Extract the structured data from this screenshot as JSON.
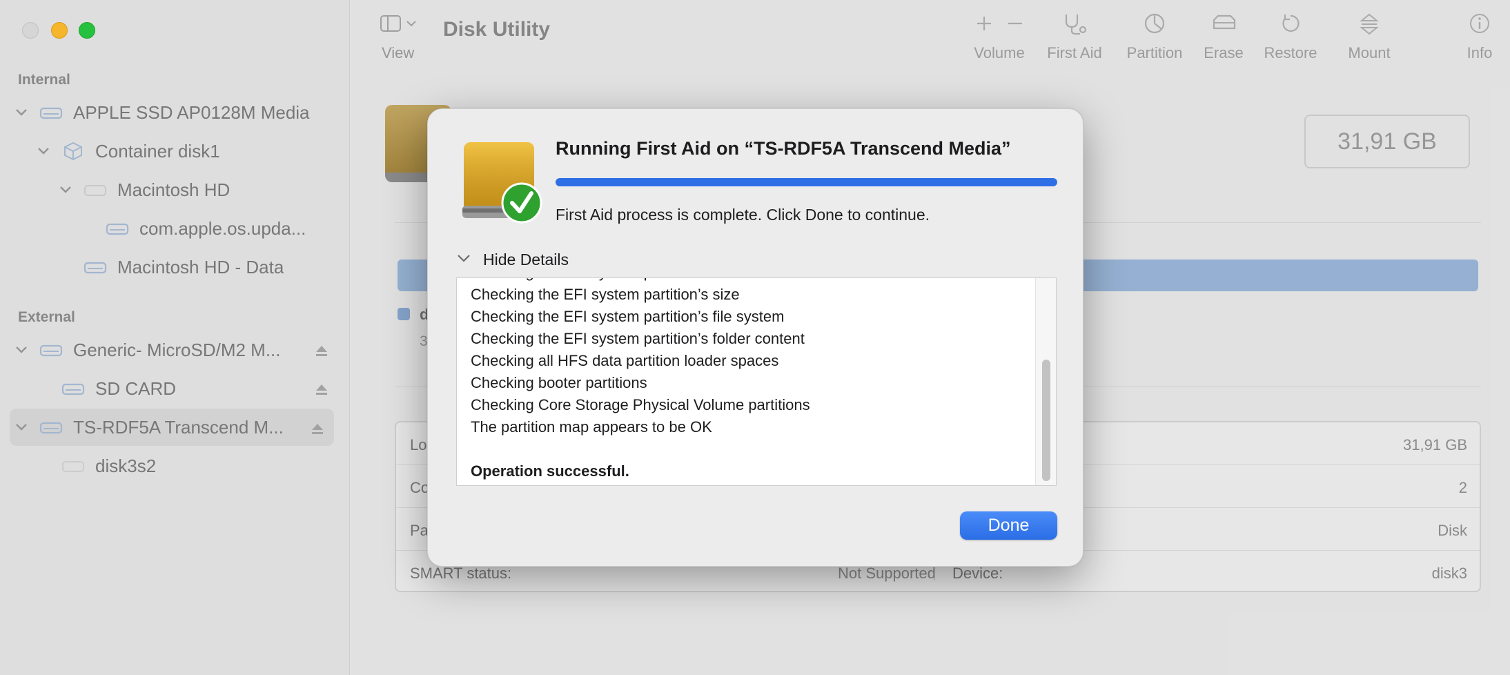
{
  "app": {
    "title": "Disk Utility"
  },
  "sidebar": {
    "internal_header": "Internal",
    "external_header": "External",
    "internal_items": [
      {
        "label": "APPLE SSD AP0128M Media",
        "icon": "drive-icon"
      },
      {
        "label": "Container disk1",
        "icon": "container-icon"
      },
      {
        "label": "Macintosh HD",
        "icon": "volume-icon"
      },
      {
        "label": "com.apple.os.upda...",
        "icon": "volume-icon"
      },
      {
        "label": "Macintosh HD - Data",
        "icon": "volume-icon"
      }
    ],
    "external_items": [
      {
        "label": "Generic- MicroSD/M2 M...",
        "icon": "drive-icon"
      },
      {
        "label": "SD CARD",
        "icon": "volume-icon"
      },
      {
        "label": "TS-RDF5A Transcend M...",
        "icon": "drive-icon"
      },
      {
        "label": "disk3s2",
        "icon": "volume-icon"
      }
    ]
  },
  "toolbar": {
    "view_label": "View",
    "volume_label": "Volume",
    "first_aid_label": "First Aid",
    "partition_label": "Partition",
    "erase_label": "Erase",
    "restore_label": "Restore",
    "mount_label": "Mount",
    "info_label": "Info"
  },
  "main": {
    "capacity": "31,91 GB",
    "legend_title": "d",
    "legend_sub": "3",
    "info_rows": [
      {
        "left_label": "Lo",
        "right_value": "31,91 GB"
      },
      {
        "left_label": "Co",
        "right_value": "2"
      },
      {
        "left_label": "Pa",
        "right_value": "Disk"
      },
      {
        "left_label": "SMART status:",
        "left_value": "Not Supported",
        "right_label": "Device:",
        "right_value": "disk3"
      }
    ]
  },
  "dialog": {
    "title": "Running First Aid on “TS-RDF5A Transcend Media”",
    "progress_percent": 100,
    "status": "First Aid process is complete. Click Done to continue.",
    "details_toggle": "Hide Details",
    "log_lines": [
      "Checking the EFI system partition",
      "Checking the EFI system partition’s size",
      "Checking the EFI system partition’s file system",
      "Checking the EFI system partition’s folder content",
      "Checking all HFS data partition loader spaces",
      "Checking booter partitions",
      "Checking Core Storage Physical Volume partitions",
      "The partition map appears to be OK",
      "",
      "Operation successful."
    ],
    "done_label": "Done"
  },
  "colors": {
    "accent": "#2f6fe6",
    "check_green": "#2ea12e",
    "drive_gold": "#d9a520"
  }
}
